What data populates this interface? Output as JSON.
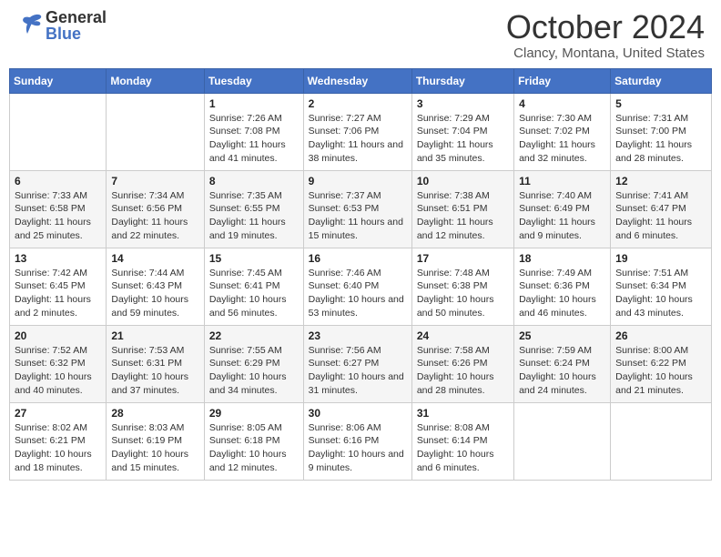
{
  "logo": {
    "line1": "General",
    "line2": "Blue"
  },
  "header": {
    "month": "October 2024",
    "location": "Clancy, Montana, United States"
  },
  "weekdays": [
    "Sunday",
    "Monday",
    "Tuesday",
    "Wednesday",
    "Thursday",
    "Friday",
    "Saturday"
  ],
  "weeks": [
    [
      {
        "day": "",
        "sunrise": "",
        "sunset": "",
        "daylight": ""
      },
      {
        "day": "",
        "sunrise": "",
        "sunset": "",
        "daylight": ""
      },
      {
        "day": "1",
        "sunrise": "Sunrise: 7:26 AM",
        "sunset": "Sunset: 7:08 PM",
        "daylight": "Daylight: 11 hours and 41 minutes."
      },
      {
        "day": "2",
        "sunrise": "Sunrise: 7:27 AM",
        "sunset": "Sunset: 7:06 PM",
        "daylight": "Daylight: 11 hours and 38 minutes."
      },
      {
        "day": "3",
        "sunrise": "Sunrise: 7:29 AM",
        "sunset": "Sunset: 7:04 PM",
        "daylight": "Daylight: 11 hours and 35 minutes."
      },
      {
        "day": "4",
        "sunrise": "Sunrise: 7:30 AM",
        "sunset": "Sunset: 7:02 PM",
        "daylight": "Daylight: 11 hours and 32 minutes."
      },
      {
        "day": "5",
        "sunrise": "Sunrise: 7:31 AM",
        "sunset": "Sunset: 7:00 PM",
        "daylight": "Daylight: 11 hours and 28 minutes."
      }
    ],
    [
      {
        "day": "6",
        "sunrise": "Sunrise: 7:33 AM",
        "sunset": "Sunset: 6:58 PM",
        "daylight": "Daylight: 11 hours and 25 minutes."
      },
      {
        "day": "7",
        "sunrise": "Sunrise: 7:34 AM",
        "sunset": "Sunset: 6:56 PM",
        "daylight": "Daylight: 11 hours and 22 minutes."
      },
      {
        "day": "8",
        "sunrise": "Sunrise: 7:35 AM",
        "sunset": "Sunset: 6:55 PM",
        "daylight": "Daylight: 11 hours and 19 minutes."
      },
      {
        "day": "9",
        "sunrise": "Sunrise: 7:37 AM",
        "sunset": "Sunset: 6:53 PM",
        "daylight": "Daylight: 11 hours and 15 minutes."
      },
      {
        "day": "10",
        "sunrise": "Sunrise: 7:38 AM",
        "sunset": "Sunset: 6:51 PM",
        "daylight": "Daylight: 11 hours and 12 minutes."
      },
      {
        "day": "11",
        "sunrise": "Sunrise: 7:40 AM",
        "sunset": "Sunset: 6:49 PM",
        "daylight": "Daylight: 11 hours and 9 minutes."
      },
      {
        "day": "12",
        "sunrise": "Sunrise: 7:41 AM",
        "sunset": "Sunset: 6:47 PM",
        "daylight": "Daylight: 11 hours and 6 minutes."
      }
    ],
    [
      {
        "day": "13",
        "sunrise": "Sunrise: 7:42 AM",
        "sunset": "Sunset: 6:45 PM",
        "daylight": "Daylight: 11 hours and 2 minutes."
      },
      {
        "day": "14",
        "sunrise": "Sunrise: 7:44 AM",
        "sunset": "Sunset: 6:43 PM",
        "daylight": "Daylight: 10 hours and 59 minutes."
      },
      {
        "day": "15",
        "sunrise": "Sunrise: 7:45 AM",
        "sunset": "Sunset: 6:41 PM",
        "daylight": "Daylight: 10 hours and 56 minutes."
      },
      {
        "day": "16",
        "sunrise": "Sunrise: 7:46 AM",
        "sunset": "Sunset: 6:40 PM",
        "daylight": "Daylight: 10 hours and 53 minutes."
      },
      {
        "day": "17",
        "sunrise": "Sunrise: 7:48 AM",
        "sunset": "Sunset: 6:38 PM",
        "daylight": "Daylight: 10 hours and 50 minutes."
      },
      {
        "day": "18",
        "sunrise": "Sunrise: 7:49 AM",
        "sunset": "Sunset: 6:36 PM",
        "daylight": "Daylight: 10 hours and 46 minutes."
      },
      {
        "day": "19",
        "sunrise": "Sunrise: 7:51 AM",
        "sunset": "Sunset: 6:34 PM",
        "daylight": "Daylight: 10 hours and 43 minutes."
      }
    ],
    [
      {
        "day": "20",
        "sunrise": "Sunrise: 7:52 AM",
        "sunset": "Sunset: 6:32 PM",
        "daylight": "Daylight: 10 hours and 40 minutes."
      },
      {
        "day": "21",
        "sunrise": "Sunrise: 7:53 AM",
        "sunset": "Sunset: 6:31 PM",
        "daylight": "Daylight: 10 hours and 37 minutes."
      },
      {
        "day": "22",
        "sunrise": "Sunrise: 7:55 AM",
        "sunset": "Sunset: 6:29 PM",
        "daylight": "Daylight: 10 hours and 34 minutes."
      },
      {
        "day": "23",
        "sunrise": "Sunrise: 7:56 AM",
        "sunset": "Sunset: 6:27 PM",
        "daylight": "Daylight: 10 hours and 31 minutes."
      },
      {
        "day": "24",
        "sunrise": "Sunrise: 7:58 AM",
        "sunset": "Sunset: 6:26 PM",
        "daylight": "Daylight: 10 hours and 28 minutes."
      },
      {
        "day": "25",
        "sunrise": "Sunrise: 7:59 AM",
        "sunset": "Sunset: 6:24 PM",
        "daylight": "Daylight: 10 hours and 24 minutes."
      },
      {
        "day": "26",
        "sunrise": "Sunrise: 8:00 AM",
        "sunset": "Sunset: 6:22 PM",
        "daylight": "Daylight: 10 hours and 21 minutes."
      }
    ],
    [
      {
        "day": "27",
        "sunrise": "Sunrise: 8:02 AM",
        "sunset": "Sunset: 6:21 PM",
        "daylight": "Daylight: 10 hours and 18 minutes."
      },
      {
        "day": "28",
        "sunrise": "Sunrise: 8:03 AM",
        "sunset": "Sunset: 6:19 PM",
        "daylight": "Daylight: 10 hours and 15 minutes."
      },
      {
        "day": "29",
        "sunrise": "Sunrise: 8:05 AM",
        "sunset": "Sunset: 6:18 PM",
        "daylight": "Daylight: 10 hours and 12 minutes."
      },
      {
        "day": "30",
        "sunrise": "Sunrise: 8:06 AM",
        "sunset": "Sunset: 6:16 PM",
        "daylight": "Daylight: 10 hours and 9 minutes."
      },
      {
        "day": "31",
        "sunrise": "Sunrise: 8:08 AM",
        "sunset": "Sunset: 6:14 PM",
        "daylight": "Daylight: 10 hours and 6 minutes."
      },
      {
        "day": "",
        "sunrise": "",
        "sunset": "",
        "daylight": ""
      },
      {
        "day": "",
        "sunrise": "",
        "sunset": "",
        "daylight": ""
      }
    ]
  ]
}
